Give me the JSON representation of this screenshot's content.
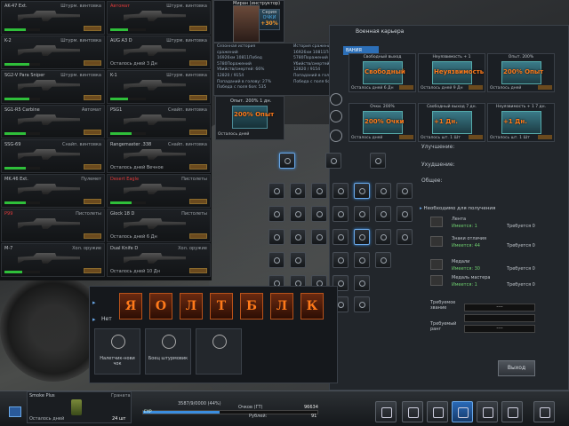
{
  "weapons": [
    {
      "name": "AK-47 Ext.",
      "cat": "Штурм. винтовка",
      "days": "",
      "red": false,
      "bar": 0.6
    },
    {
      "name": "Автомат",
      "cat": "Штурм. винтовка",
      "days": "",
      "red": true,
      "bar": 0.5
    },
    {
      "name": "K-2",
      "cat": "Штурм. винтовка",
      "days": "",
      "red": false,
      "bar": 0.7
    },
    {
      "name": "AUG A3 D",
      "cat": "Штурм. винтовка",
      "days": "Осталось дней 3 Дн",
      "red": false,
      "bar": 0
    },
    {
      "name": "SG2-V Para Sniper",
      "cat": "Штурм. винтовка",
      "days": "",
      "red": false,
      "bar": 0.7
    },
    {
      "name": "K-1",
      "cat": "Штурм. винтовка",
      "days": "",
      "red": false,
      "bar": 0.5
    },
    {
      "name": "SG1-R5 Carbine",
      "cat": "Автомат",
      "days": "",
      "red": false,
      "bar": 0.6
    },
    {
      "name": "PSG1",
      "cat": "Снайп. винтовка",
      "days": "",
      "red": false,
      "bar": 0.6
    },
    {
      "name": "SSG-69",
      "cat": "Снайп. винтовка",
      "days": "",
      "red": false,
      "bar": 0.6
    },
    {
      "name": "Rangemaster .338",
      "cat": "Снайп. винтовка",
      "days": "Осталось дней Вечное",
      "red": false,
      "bar": 0
    },
    {
      "name": "MK.46 Ext.",
      "cat": "Пулемет",
      "days": "",
      "red": false,
      "bar": 0.6
    },
    {
      "name": "Desert Eagle",
      "cat": "Пистолеты",
      "days": "",
      "red": true,
      "bar": 0.6
    },
    {
      "name": "P99",
      "cat": "Пистолеты",
      "days": "",
      "red": true,
      "bar": 0
    },
    {
      "name": "Glock 18 D",
      "cat": "Пистолеты",
      "days": "Осталось дней 6 Дн",
      "red": false,
      "bar": 0
    },
    {
      "name": "M-7",
      "cat": "Хол. оружие",
      "days": "",
      "red": false,
      "bar": 0.5
    },
    {
      "name": "Dual Knife D",
      "cat": "Хол. оружие",
      "days": "Осталось дней 10 Дн",
      "red": false,
      "bar": 0
    }
  ],
  "profile": {
    "name": "Миран (инструктор)",
    "badge_label": "Серия",
    "badge_points": "ОЧКИ",
    "badge_pct": "+30%"
  },
  "history": {
    "left": [
      "Сезонная история",
      "сражений",
      "16926хм 10811Побед",
      "5780Поражений",
      "Убийств/смертей: 66%",
      "12820 / 9154",
      "Попаданий в голову: 27%",
      "Победа с поля боя: 535"
    ],
    "right": [
      "История сражений",
      "16926хм 10811Побед",
      "5780Поражений",
      "Убийств/смертей: 66%",
      "12820 / 9154",
      "Попаданий в голову: 27%",
      "Победа с поля боя: 535"
    ]
  },
  "small_booster": {
    "header": "Опыт. 200% 1 дн.",
    "text": "200% Опыт",
    "footer": "Осталось дней"
  },
  "career": {
    "title": "Военная карьера",
    "tab": "ВАНИЯ",
    "boosters": [
      {
        "header": "Свободный выход",
        "text": "Свободный",
        "footer": "Осталось дней 6 Дн"
      },
      {
        "header": "Неуязвимость + 1",
        "text": "Неуязвимость",
        "footer": "Осталось дней 9 Дн"
      },
      {
        "header": "Опыт. 200%",
        "text": "200% Опыт",
        "footer": "Осталось дней"
      },
      {
        "header": "Очки. 200%",
        "text": "200% Очки",
        "footer": "Осталось дней"
      },
      {
        "header": "Свободный выход 7 дн.",
        "text": "+1 Дн.",
        "footer": "Осталось шт. 1 Шт"
      },
      {
        "header": "Неуязвимость + 1 7 дн.",
        "text": "+1 Дн.",
        "footer": "Осталось шт. 1 Шт"
      }
    ],
    "changes": [
      "Улучшение:",
      "Ухудшение:",
      "Общее:"
    ],
    "requirements_title": "Необходимо для получения",
    "requirements": [
      {
        "label": "Лента",
        "have": "Имеется: 1",
        "need": "Требуется 0"
      },
      {
        "label": "Знаки отличия",
        "have": "Имеется: 44",
        "need": "Требуется 0"
      },
      {
        "label": "Медали",
        "have": "Имеется: 30",
        "need": "Требуется 0"
      },
      {
        "label": "Медаль мастера",
        "have": "Имеется: 1",
        "need": "Требуется 0"
      }
    ],
    "rank_req_label": "Требуемое звание",
    "rank_req_value": "----",
    "req_rank_label": "Требуемый ранг",
    "req_rank_value": "----",
    "exit": "Выход"
  },
  "popup": {
    "letters": [
      "Я",
      "О",
      "Л",
      "Т",
      "Б",
      "Л",
      "К"
    ],
    "net_label": "Нет",
    "badges": [
      {
        "label": "Налетчик-нови чок"
      },
      {
        "label": "Боец штурмовик"
      },
      {
        "label": ""
      }
    ]
  },
  "bottom": {
    "item_name": "Smoke Plus",
    "item_cat": "Граната",
    "item_days": "Осталось дней",
    "item_count": "24 шт",
    "exp_text": "3587/9/0000 (44%)",
    "exp_label": "EXP",
    "exp_fill": 0.44,
    "points_label": "Очков (ГТ)",
    "points_value": "96634",
    "rub_label": "Рублей:",
    "rub_value": "91"
  },
  "colors": {
    "accent": "#3b8ee0",
    "orange": "#ff7a1a",
    "green": "#2fbf3a",
    "red": "#e03a3a"
  }
}
